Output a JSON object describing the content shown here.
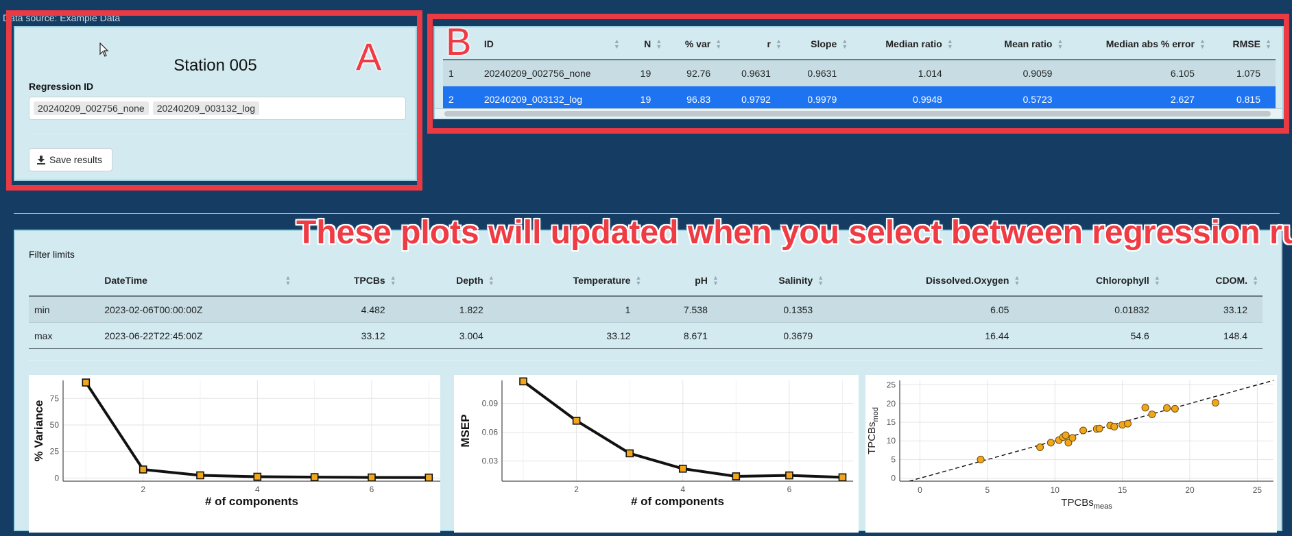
{
  "data_source": "Data source: Example Data",
  "panel_a": {
    "letter": "A",
    "station_title": "Station 005",
    "regression_label": "Regression ID",
    "regression_chips": [
      "20240209_002756_none",
      "20240209_003132_log"
    ],
    "save_button": "Save results"
  },
  "panel_b": {
    "letter": "B",
    "columns": [
      "ID",
      "N",
      "% var",
      "r",
      "Slope",
      "Median ratio",
      "Mean ratio",
      "Median abs % error",
      "RMSE"
    ],
    "rows": [
      {
        "idx": "1",
        "id": "20240209_002756_none",
        "n": "19",
        "pvar": "92.76",
        "r": "0.9631",
        "slope": "0.9631",
        "median_ratio": "1.014",
        "mean_ratio": "0.9059",
        "mape": "6.105",
        "rmse": "1.075"
      },
      {
        "idx": "2",
        "id": "20240209_003132_log",
        "n": "19",
        "pvar": "96.83",
        "r": "0.9792",
        "slope": "0.9979",
        "median_ratio": "0.9948",
        "mean_ratio": "0.5723",
        "mape": "2.627",
        "rmse": "0.815"
      }
    ],
    "selected_row": 2
  },
  "annotation": "These plots will updated when you select between regression runs",
  "filter": {
    "label": "Filter limits",
    "columns": [
      "",
      "DateTime",
      "TPCBs",
      "Depth",
      "Temperature",
      "pH",
      "Salinity",
      "Dissolved.Oxygen",
      "Chlorophyll",
      "CDOM."
    ],
    "rows": [
      [
        "min",
        "2023-02-06T00:00:00Z",
        "4.482",
        "1.822",
        "1",
        "7.538",
        "0.1353",
        "6.05",
        "0.01832",
        "33.12"
      ],
      [
        "max",
        "2023-06-22T22:45:00Z",
        "33.12",
        "3.004",
        "33.12",
        "8.671",
        "0.3679",
        "16.44",
        "54.6",
        "148.4"
      ]
    ]
  },
  "chart_data": [
    {
      "type": "line",
      "xlabel": "# of components",
      "ylabel": "% Variance",
      "x": [
        1,
        2,
        3,
        4,
        5,
        6,
        7
      ],
      "y": [
        90,
        8,
        2.5,
        1.2,
        0.8,
        0.5,
        0.4
      ],
      "xticks": [
        2,
        4,
        6
      ],
      "yticks": [
        0,
        25,
        50,
        75
      ],
      "xlim": [
        0.6,
        7.2
      ],
      "ylim": [
        -3,
        92
      ]
    },
    {
      "type": "line",
      "xlabel": "# of components",
      "ylabel": "MSEP",
      "x": [
        1,
        2,
        3,
        4,
        5,
        6,
        7
      ],
      "y": [
        0.113,
        0.072,
        0.038,
        0.022,
        0.014,
        0.015,
        0.013
      ],
      "xticks": [
        2,
        4,
        6
      ],
      "yticks": [
        0.03,
        0.06,
        0.09
      ],
      "ytick_labels": [
        "0.03",
        "0.06",
        "0.09"
      ],
      "xlim": [
        0.6,
        7.2
      ],
      "ylim": [
        0.009,
        0.114
      ]
    },
    {
      "type": "scatter",
      "xlabel": "TPCBs",
      "xlabel_sub": "meas",
      "ylabel": "TPCBs",
      "ylabel_sub": "mod",
      "xticks": [
        0,
        5,
        10,
        15,
        20,
        25
      ],
      "yticks": [
        0,
        5,
        10,
        15,
        20,
        25
      ],
      "xlim": [
        -1.5,
        26.2
      ],
      "ylim": [
        -0.8,
        26.2
      ],
      "reference_line": "y = x (dashed)",
      "points": [
        [
          4.5,
          5.0
        ],
        [
          8.9,
          8.3
        ],
        [
          9.7,
          9.5
        ],
        [
          10.3,
          10.2
        ],
        [
          10.6,
          11.0
        ],
        [
          10.8,
          11.5
        ],
        [
          11.0,
          9.5
        ],
        [
          11.3,
          10.8
        ],
        [
          12.1,
          12.8
        ],
        [
          13.1,
          13.2
        ],
        [
          13.3,
          13.3
        ],
        [
          14.1,
          14.1
        ],
        [
          14.4,
          13.8
        ],
        [
          15.0,
          14.3
        ],
        [
          15.4,
          14.6
        ],
        [
          16.7,
          18.9
        ],
        [
          17.2,
          17.1
        ],
        [
          18.3,
          18.8
        ],
        [
          18.9,
          18.6
        ],
        [
          21.9,
          20.2
        ]
      ]
    }
  ]
}
